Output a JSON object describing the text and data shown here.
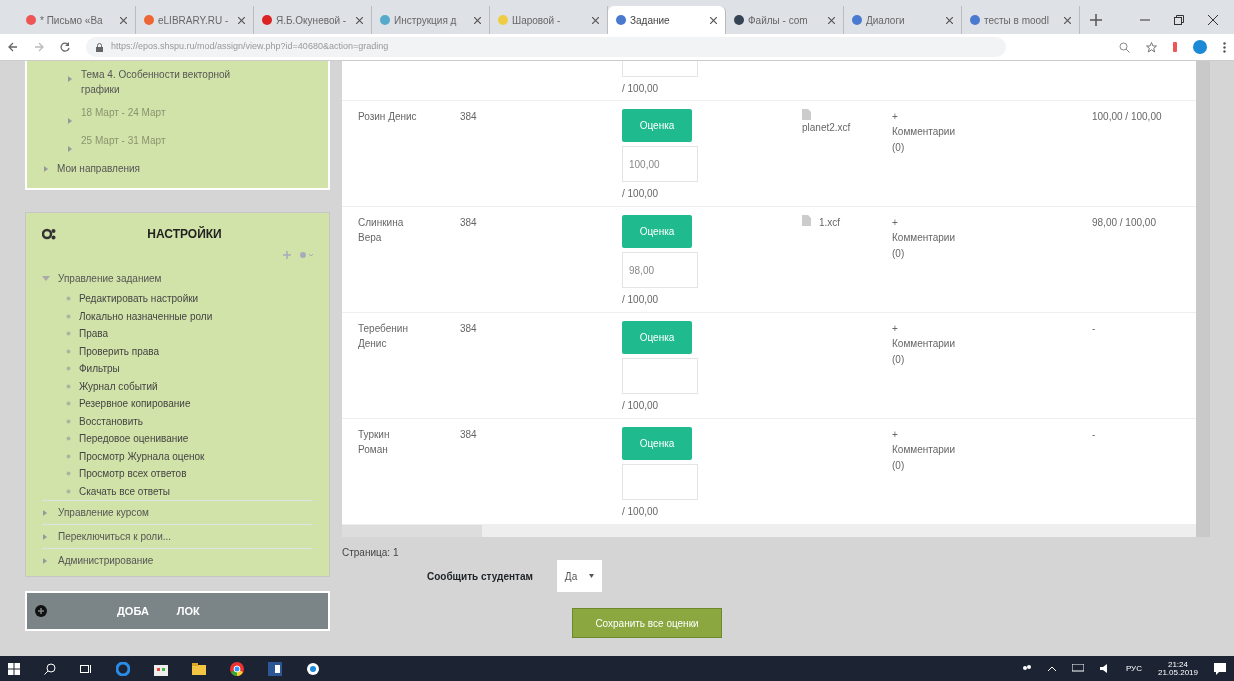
{
  "browser": {
    "tabs": [
      {
        "title": "* Письмо «Ва",
        "selected": false
      },
      {
        "title": "eLIBRARY.RU -",
        "selected": false
      },
      {
        "title": "Я.Б.Окуневой -",
        "selected": false
      },
      {
        "title": "Инструкция д",
        "selected": false
      },
      {
        "title": "Шаровой -",
        "selected": false
      },
      {
        "title": "Задание",
        "selected": true
      },
      {
        "title": "Файлы - com",
        "selected": false
      },
      {
        "title": "Диалоги",
        "selected": false
      },
      {
        "title": "тесты в moodl",
        "selected": false
      }
    ],
    "url": "https://epos.shspu.ru/mod/assign/view.php?id=40680&action=grading"
  },
  "nav_block": {
    "course_items": [
      {
        "label": "Тема 4. Особенности векторной графики",
        "dimmed": false
      },
      {
        "label": "18 Март - 24 Март",
        "dimmed": true
      },
      {
        "label": "25 Март - 31 Март",
        "dimmed": true
      }
    ],
    "top_items": [
      {
        "label": "Мои направления"
      }
    ]
  },
  "settings_block": {
    "title": "НАСТРОЙКИ",
    "items": [
      {
        "label": "Управление заданием",
        "expanded": true,
        "children": [
          {
            "label": "Редактировать настройки"
          },
          {
            "label": "Локально назначенные роли"
          },
          {
            "label": "Права"
          },
          {
            "label": "Проверить права"
          },
          {
            "label": "Фильтры"
          },
          {
            "label": "Журнал событий"
          },
          {
            "label": "Резервное копирование"
          },
          {
            "label": "Восстановить"
          },
          {
            "label": "Передовое оценивание"
          },
          {
            "label": "Просмотр Журнала оценок"
          },
          {
            "label": "Просмотр всех ответов"
          },
          {
            "label": "Скачать все ответы"
          }
        ]
      },
      {
        "label": "Управление курсом",
        "expanded": false
      },
      {
        "label": "Переключиться к роли...",
        "expanded": false
      },
      {
        "label": "Администрирование",
        "expanded": false
      }
    ]
  },
  "add_block": {
    "label_start": "ДОБА",
    "label_end": "ЛОК"
  },
  "grading_table": {
    "rows": [
      {
        "kind": "partial",
        "max": "/ 100,00"
      },
      {
        "kind": "full",
        "name": "Розин Денис",
        "group": "384",
        "grade_button": "Оценка",
        "grade": "100,00",
        "max": "/ 100,00",
        "file": "planet2.xcf",
        "toggle": "+",
        "comments": "Комментарии (0)",
        "final": "100,00 / 100,00"
      },
      {
        "kind": "full",
        "name": "Слинкина Вера",
        "group": "384",
        "grade_button": "Оценка",
        "grade": "98,00",
        "max": "/ 100,00",
        "file": "1.xcf",
        "toggle": "+",
        "comments": "Комментарии (0)",
        "final": "98,00 / 100,00"
      },
      {
        "kind": "full",
        "name": "Теребенин Денис",
        "group": "384",
        "grade_button": "Оценка",
        "max": "/ 100,00",
        "toggle": "+",
        "comments": "Комментарии (0)",
        "final": "-"
      },
      {
        "kind": "full",
        "name": "Туркин Роман",
        "group": "384",
        "grade_button": "Оценка",
        "max": "/ 100,00",
        "toggle": "+",
        "comments": "Комментарии (0)",
        "final": "-"
      }
    ]
  },
  "page_label": "Страница: 1",
  "notify": {
    "label": "Сообщить студентам",
    "value": "Да"
  },
  "save_button": "Сохранить все оценки",
  "taskbar": {
    "language": "РУС",
    "time": "21:24",
    "date": "21.05.2019"
  }
}
